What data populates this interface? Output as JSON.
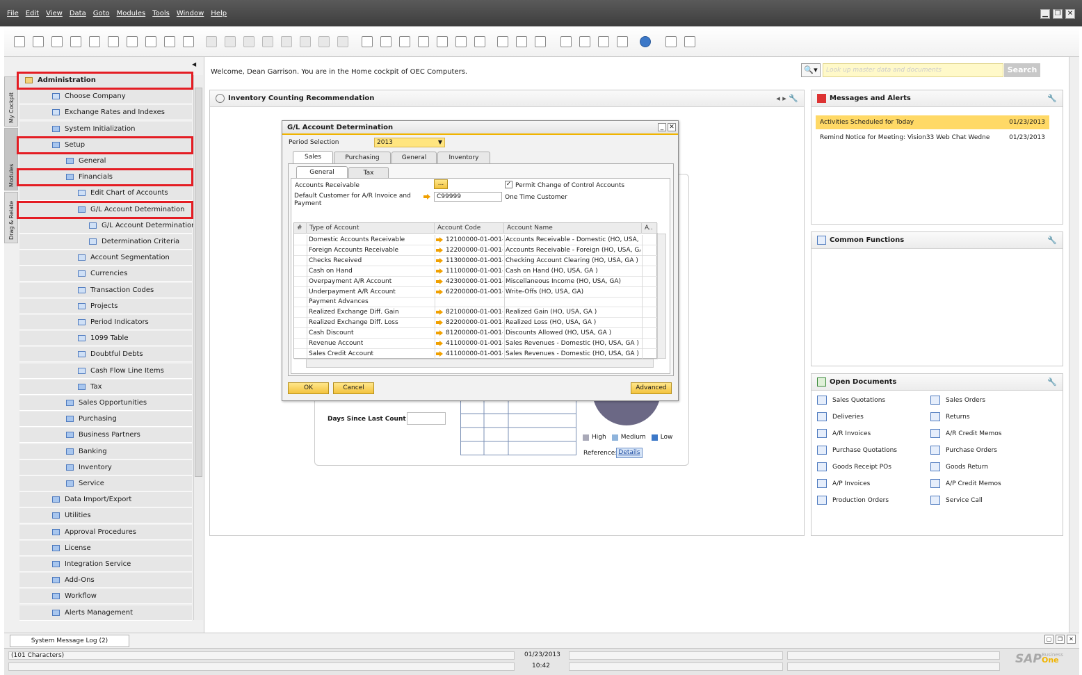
{
  "menu": [
    "File",
    "Edit",
    "View",
    "Data",
    "Goto",
    "Modules",
    "Tools",
    "Window",
    "Help"
  ],
  "window_controls": [
    "▁",
    "❐",
    "✕"
  ],
  "side_tabs": [
    "My Cockpit",
    "Modules",
    "Drag & Relate"
  ],
  "tree": [
    {
      "label": "Administration",
      "level": 0,
      "bold": true,
      "icon": "folder"
    },
    {
      "label": "Choose Company",
      "level": 1,
      "icon": "window"
    },
    {
      "label": "Exchange Rates and Indexes",
      "level": 1,
      "icon": "window"
    },
    {
      "label": "System Initialization",
      "level": 1,
      "icon": "folder"
    },
    {
      "label": "Setup",
      "level": 1,
      "icon": "folder-open"
    },
    {
      "label": "General",
      "level": 2,
      "icon": "folder"
    },
    {
      "label": "Financials",
      "level": 2,
      "icon": "folder-open"
    },
    {
      "label": "Edit Chart of Accounts",
      "level": 3,
      "icon": "window"
    },
    {
      "label": "G/L Account Determination",
      "level": 3,
      "icon": "folder-open"
    },
    {
      "label": "G/L Account Determination",
      "level": 4,
      "icon": "window"
    },
    {
      "label": "Determination Criteria",
      "level": 4,
      "icon": "window"
    },
    {
      "label": "Account Segmentation",
      "level": 3,
      "icon": "window"
    },
    {
      "label": "Currencies",
      "level": 3,
      "icon": "window"
    },
    {
      "label": "Transaction Codes",
      "level": 3,
      "icon": "window"
    },
    {
      "label": "Projects",
      "level": 3,
      "icon": "window"
    },
    {
      "label": "Period Indicators",
      "level": 3,
      "icon": "window"
    },
    {
      "label": "1099 Table",
      "level": 3,
      "icon": "window"
    },
    {
      "label": "Doubtful Debts",
      "level": 3,
      "icon": "window"
    },
    {
      "label": "Cash Flow Line Items",
      "level": 3,
      "icon": "window"
    },
    {
      "label": "Tax",
      "level": 3,
      "icon": "folder"
    },
    {
      "label": "Sales Opportunities",
      "level": 2,
      "icon": "folder"
    },
    {
      "label": "Purchasing",
      "level": 2,
      "icon": "folder"
    },
    {
      "label": "Business Partners",
      "level": 2,
      "icon": "folder"
    },
    {
      "label": "Banking",
      "level": 2,
      "icon": "folder"
    },
    {
      "label": "Inventory",
      "level": 2,
      "icon": "folder"
    },
    {
      "label": "Service",
      "level": 2,
      "icon": "folder"
    },
    {
      "label": "Data Import/Export",
      "level": 1,
      "icon": "folder"
    },
    {
      "label": "Utilities",
      "level": 1,
      "icon": "folder"
    },
    {
      "label": "Approval Procedures",
      "level": 1,
      "icon": "folder"
    },
    {
      "label": "License",
      "level": 1,
      "icon": "folder"
    },
    {
      "label": "Integration Service",
      "level": 1,
      "icon": "folder"
    },
    {
      "label": "Add-Ons",
      "level": 1,
      "icon": "folder"
    },
    {
      "label": "Workflow",
      "level": 1,
      "icon": "folder"
    },
    {
      "label": "Alerts Management",
      "level": 1,
      "icon": "folder"
    }
  ],
  "highlighted_rows": [
    0,
    4,
    6,
    8
  ],
  "welcome": "Welcome, Dean Garrison. You are in the Home cockpit of OEC Computers.",
  "search": {
    "placeholder": "Look up master data and documents",
    "button": "Search"
  },
  "inventory_panel": {
    "title": "Inventory Counting Recommendation",
    "days_label": "Days Since Last Count",
    "legend": [
      "High",
      "Medium",
      "Low"
    ],
    "legend_colors": [
      "#a9a9b8",
      "#8fb4dc",
      "#3c78c8"
    ],
    "reference_label": "Reference:",
    "details_button": "Details"
  },
  "messages_panel": {
    "title": "Messages and Alerts",
    "rows": [
      {
        "text": "Activities Scheduled for Today",
        "date": "01/23/2013",
        "selected": true
      },
      {
        "text": "Remind Notice for Meeting: Vision33 Web Chat Wedne",
        "date": "01/23/2013",
        "selected": false
      }
    ]
  },
  "common_functions_panel": {
    "title": "Common Functions"
  },
  "open_documents_panel": {
    "title": "Open Documents",
    "left": [
      "Sales Quotations",
      "Deliveries",
      "A/R Invoices",
      "Purchase Quotations",
      "Goods Receipt POs",
      "A/P Invoices",
      "Production Orders"
    ],
    "right": [
      "Sales Orders",
      "Returns",
      "A/R Credit Memos",
      "Purchase Orders",
      "Goods Return",
      "A/P Credit Memos",
      "Service Call"
    ]
  },
  "dialog": {
    "title": "G/L Account Determination",
    "period_label": "Period Selection",
    "period_value": "2013",
    "tabs": [
      "Sales",
      "Purchasing",
      "General",
      "Inventory"
    ],
    "subtabs": [
      "General",
      "Tax"
    ],
    "accounts_receivable_label": "Accounts Receivable",
    "ellipsis": "...",
    "permit_label": "Permit Change of Control Accounts",
    "default_customer_label": "Default Customer for A/R Invoice and Payment",
    "default_customer_value": "C99999",
    "one_time_customer": "One Time Customer",
    "columns": [
      "#",
      "Type of Account",
      "Account Code",
      "Account Name",
      "A.."
    ],
    "rows": [
      {
        "type": "Domestic Accounts Receivable",
        "code": "12100000-01-001-01",
        "name": "Accounts Receivable - Domestic (HO, USA, GA"
      },
      {
        "type": "Foreign Accounts Receivable",
        "code": "12200000-01-001-01",
        "name": "Accounts Receivable - Foreign (HO, USA, GA )"
      },
      {
        "type": "Checks Received",
        "code": "11300000-01-001-01",
        "name": "Checking Account Clearing (HO, USA, GA )"
      },
      {
        "type": "Cash on Hand",
        "code": "11100000-01-001-01",
        "name": "Cash on Hand (HO, USA, GA )"
      },
      {
        "type": "Overpayment A/R Account",
        "code": "42300000-01-001-01",
        "name": "Miscellaneous Income (HO, USA, GA)"
      },
      {
        "type": "Underpayment A/R Account",
        "code": "62200000-01-001-01",
        "name": "Write-Offs (HO, USA, GA)"
      },
      {
        "type": "Payment Advances",
        "code": "",
        "name": ""
      },
      {
        "type": "Realized Exchange Diff. Gain",
        "code": "82100000-01-001-01",
        "name": "Realized Gain (HO, USA, GA )"
      },
      {
        "type": "Realized Exchange Diff. Loss",
        "code": "82200000-01-001-01",
        "name": "Realized Loss (HO, USA, GA )"
      },
      {
        "type": "Cash Discount",
        "code": "81200000-01-001-01",
        "name": "Discounts Allowed (HO, USA, GA )"
      },
      {
        "type": "Revenue Account",
        "code": "41100000-01-001-01",
        "name": "Sales Revenues - Domestic (HO, USA, GA )"
      },
      {
        "type": "Sales Credit Account",
        "code": "41100000-01-001-01",
        "name": "Sales Revenues - Domestic (HO, USA, GA )"
      }
    ],
    "ok": "OK",
    "cancel": "Cancel",
    "advanced": "Advanced"
  },
  "bottom": {
    "syslog": "System Message Log (2)",
    "characters": "(101 Characters)",
    "date": "01/23/2013",
    "time": "10:42",
    "logo": "SAP",
    "logo_sub1": "Business",
    "logo_sub2": "One"
  }
}
